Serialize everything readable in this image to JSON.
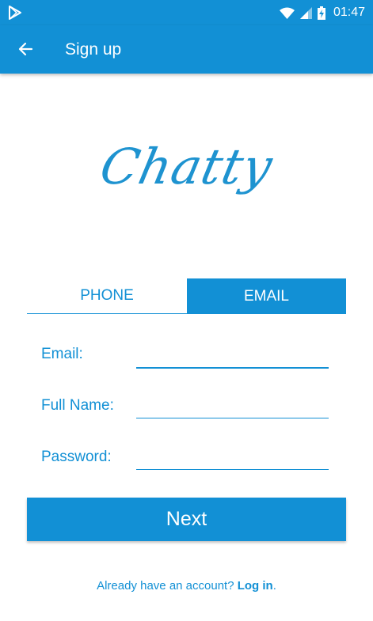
{
  "status_bar": {
    "time": "01:47",
    "icons": [
      "play-store-icon",
      "wifi-icon",
      "signal-icon",
      "battery-charging-icon"
    ]
  },
  "app_bar": {
    "back_icon": "arrow-left-icon",
    "title": "Sign up"
  },
  "logo": {
    "text": "Chatty"
  },
  "tabs": [
    {
      "label": "PHONE",
      "selected": false
    },
    {
      "label": "EMAIL",
      "selected": true
    }
  ],
  "form": {
    "email_label": "Email:",
    "email_value": "",
    "name_label": "Full Name:",
    "name_value": "",
    "password_label": "Password:",
    "password_value": ""
  },
  "next_button": "Next",
  "login_prompt": {
    "text": "Already have an account? ",
    "link": "Log in",
    "suffix": "."
  },
  "colors": {
    "primary": "#1290d5",
    "background": "#ffffff"
  }
}
